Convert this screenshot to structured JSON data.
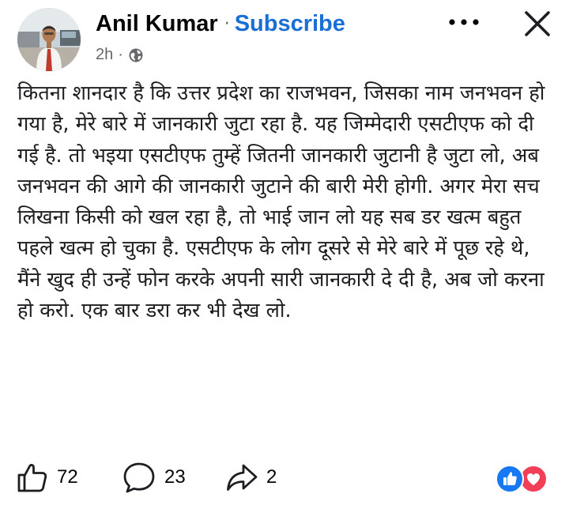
{
  "post": {
    "author": "Anil Kumar",
    "separator": "·",
    "subscribe_label": "Subscribe",
    "time": "2h",
    "meta_separator": "·",
    "audience_icon": "globe-icon",
    "body": "कितना शानदार है कि उत्तर प्रदेश का राजभवन, जिसका नाम जनभवन हो गया है, मेरे बारे में जानकारी जुटा रहा है. यह जिम्मेदारी एसटीएफ को दी गई है. तो भइया एसटीएफ तुम्हें जितनी जानकारी जुटानी है जुटा लो, अब जनभवन की आगे की जानकारी जुटाने की बारी मेरी होगी. अगर मेरा सच लिखना किसी को खल रहा है, तो भाई जान लो यह सब डर खत्म बहुत पहले खत्म हो चुका है. एसटीएफ के लोग दूसरे से मेरे बारे में पूछ रहे थे, मैंने खुद ही उन्हें फोन करके अपनी सारी जानकारी दे दी है, अब जो करना हो करो. एक बार डरा कर भी देख लो."
  },
  "actions": {
    "like_count": "72",
    "comment_count": "23",
    "share_count": "2"
  },
  "icons": {
    "more": "more-options-icon",
    "close": "close-icon",
    "like": "thumbs-up-icon",
    "comment": "comment-icon",
    "share": "share-icon",
    "reaction_like": "like-reaction-icon",
    "reaction_love": "love-reaction-icon"
  },
  "colors": {
    "subscribe": "#1a6fd6",
    "meta": "#65676b",
    "reaction_like": "#1877f2",
    "reaction_love": "#f33e58"
  }
}
